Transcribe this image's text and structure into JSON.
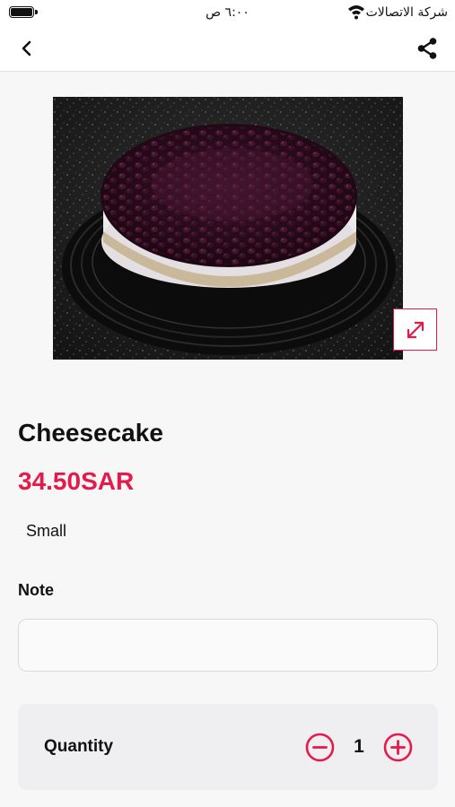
{
  "status_bar": {
    "time": "٦:٠٠ ص",
    "carrier": "شركة الاتصالات"
  },
  "icons": {
    "back": "chevron-left-icon",
    "share": "share-icon",
    "expand": "expand-icon",
    "minus": "minus-circle-icon",
    "plus": "plus-circle-icon"
  },
  "colors": {
    "accent": "#e6194b",
    "background": "#f7f7f7",
    "card": "#efeff1"
  },
  "product": {
    "name": "Cheesecake",
    "price": "34.50SAR",
    "size": "Small"
  },
  "note": {
    "label": "Note",
    "value": "",
    "placeholder": ""
  },
  "quantity": {
    "label": "Quantity",
    "value": "1"
  }
}
